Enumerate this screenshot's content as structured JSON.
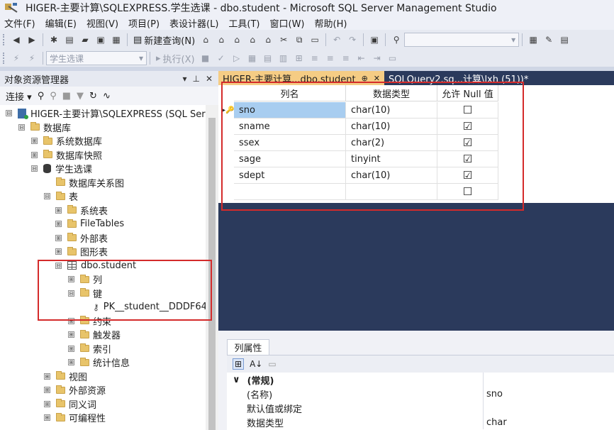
{
  "window": {
    "title": "HIGER-主要计算\\SQLEXPRESS.学生选课 - dbo.student - Microsoft SQL Server Management Studio",
    "icon": "ssms-icon"
  },
  "menu": [
    "文件(F)",
    "编辑(E)",
    "视图(V)",
    "项目(P)",
    "表设计器(L)",
    "工具(T)",
    "窗口(W)",
    "帮助(H)"
  ],
  "toolbar1": {
    "new_query_label": "新建查询(N)"
  },
  "toolbar2": {
    "database_combo": "学生选课",
    "execute_label": "执行(X)"
  },
  "object_explorer": {
    "title": "对象资源管理器",
    "pin": "⊥",
    "close": "✕",
    "dropdown": "▾",
    "connect_label": "连接",
    "tree": [
      {
        "label": "HIGER-主要计算\\SQLEXPRESS (SQL Ser",
        "kind": "server",
        "expander": "⊟"
      },
      {
        "label": "数据库",
        "kind": "folder",
        "expander": "⊟"
      },
      {
        "label": "系统数据库",
        "kind": "folder",
        "expander": "⊞"
      },
      {
        "label": "数据库快照",
        "kind": "folder",
        "expander": "⊞"
      },
      {
        "label": "学生选课",
        "kind": "database",
        "expander": "⊟"
      },
      {
        "label": "数据库关系图",
        "kind": "folder",
        "expander": ""
      },
      {
        "label": "表",
        "kind": "folder",
        "expander": "⊟"
      },
      {
        "label": "系统表",
        "kind": "folder",
        "expander": "⊞"
      },
      {
        "label": "FileTables",
        "kind": "folder",
        "expander": "⊞"
      },
      {
        "label": "外部表",
        "kind": "folder",
        "expander": "⊞"
      },
      {
        "label": "图形表",
        "kind": "folder",
        "expander": "⊞"
      },
      {
        "label": "dbo.student",
        "kind": "table",
        "expander": "⊟"
      },
      {
        "label": "列",
        "kind": "folder",
        "expander": "⊞"
      },
      {
        "label": "键",
        "kind": "folder",
        "expander": "⊟"
      },
      {
        "label": "PK__student__DDDF64",
        "kind": "key",
        "expander": ""
      },
      {
        "label": "约束",
        "kind": "folder",
        "expander": "⊞"
      },
      {
        "label": "触发器",
        "kind": "folder",
        "expander": "⊞"
      },
      {
        "label": "索引",
        "kind": "folder",
        "expander": "⊞"
      },
      {
        "label": "统计信息",
        "kind": "folder",
        "expander": "⊞"
      },
      {
        "label": "视图",
        "kind": "folder",
        "expander": "⊞"
      },
      {
        "label": "外部资源",
        "kind": "folder",
        "expander": "⊞"
      },
      {
        "label": "同义词",
        "kind": "folder",
        "expander": "⊞"
      },
      {
        "label": "可编程性",
        "kind": "folder",
        "expander": "⊞"
      }
    ]
  },
  "doc_tabs": [
    {
      "label": "HIGER-主要计算...dbo.student",
      "pin": "⊕",
      "close": "✕",
      "active": true
    },
    {
      "label": "SQLQuery2.sq...计算\\lxh (51))*",
      "active": false
    }
  ],
  "designer": {
    "headers": [
      "列名",
      "数据类型",
      "允许 Null 值"
    ],
    "pk_marker": "▸🔑",
    "rows": [
      {
        "name": "sno",
        "type": "char(10)",
        "nullable": "☐"
      },
      {
        "name": "sname",
        "type": "char(10)",
        "nullable": "☑"
      },
      {
        "name": "ssex",
        "type": "char(2)",
        "nullable": "☑"
      },
      {
        "name": "sage",
        "type": "tinyint",
        "nullable": "☑"
      },
      {
        "name": "sdept",
        "type": "char(10)",
        "nullable": "☑"
      },
      {
        "name": "",
        "type": "",
        "nullable": "☐"
      }
    ]
  },
  "properties": {
    "tab_label": "列属性",
    "category": "(常规)",
    "category_toggle": "∨",
    "rows": [
      {
        "name": "(名称)",
        "value": "sno"
      },
      {
        "name": "默认值或绑定",
        "value": ""
      },
      {
        "name": "数据类型",
        "value": "char"
      }
    ]
  },
  "colors": {
    "highlight": "#d42b2b",
    "active_tab": "#f5cc84",
    "dark_bg": "#2b3a5c",
    "selection": "#a8cdf0"
  }
}
